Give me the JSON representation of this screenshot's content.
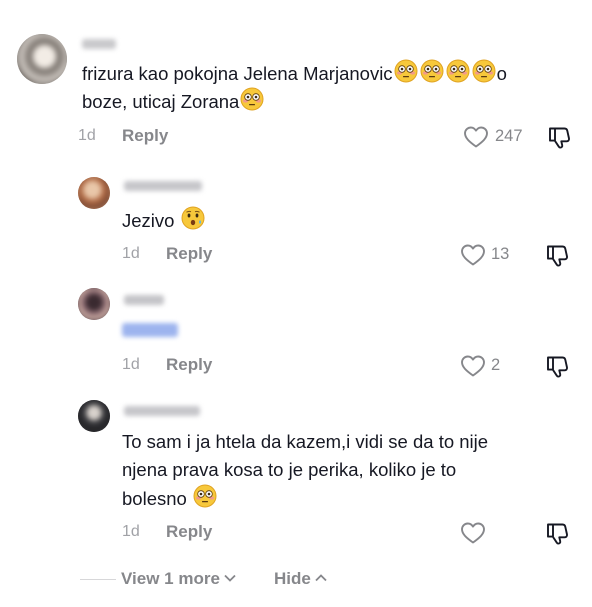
{
  "comments": [
    {
      "text": "frizura kao pokojna Jelena Marjanovic😳😳😳😳o boze, uticaj Zorana😳",
      "text_line1": "frizura kao pokojna Jelena Marjanovic",
      "text_line1_tail": "o",
      "text_line2": "boze, uticaj Zorana",
      "time": "1d",
      "reply_label": "Reply",
      "likes": "247",
      "avatar_icon": "avatar-blurred",
      "emoji": "flushed-face-emoji"
    },
    {
      "text": "Jezivo 😯",
      "text_line1": "Jezivo",
      "time": "1d",
      "reply_label": "Reply",
      "likes": "13",
      "avatar_icon": "avatar-blurred",
      "emoji": "hushed-face-emoji"
    },
    {
      "text": "",
      "mention_blurred": true,
      "time": "1d",
      "reply_label": "Reply",
      "likes": "2",
      "avatar_icon": "avatar-blurred"
    },
    {
      "text": "To sam i ja htela da kazem,i vidi se da to nije njena prava kosa to je perika, koliko je to bolesno 😳",
      "text_line1": "To sam i ja htela da kazem,i vidi se da to nije",
      "text_line2": "njena prava kosa to je perika, koliko je to",
      "text_line3": "bolesno",
      "time": "1d",
      "reply_label": "Reply",
      "likes": "",
      "avatar_icon": "avatar-blurred",
      "emoji": "flushed-face-emoji"
    }
  ],
  "footer": {
    "view_more_label": "View 1 more",
    "hide_label": "Hide"
  },
  "colors": {
    "text": "#161823",
    "secondary": "#86878b",
    "time": "#a1a2a7",
    "mention": "#9db4ee"
  },
  "icons": [
    "heart-outline-icon",
    "dislike-icon",
    "chevron-down-icon",
    "chevron-up-icon"
  ]
}
